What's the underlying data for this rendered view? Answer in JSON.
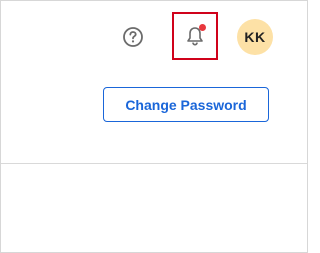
{
  "header": {
    "help_icon": "question-circle-icon",
    "notifications_icon": "bell-icon",
    "has_unread_notifications": true,
    "avatar_initials": "KK"
  },
  "main": {
    "change_password_label": "Change Password"
  },
  "colors": {
    "accent": "#1a66d9",
    "highlight_border": "#d0021b",
    "notification_dot": "#e8373d",
    "avatar_bg": "#fde1a6"
  }
}
